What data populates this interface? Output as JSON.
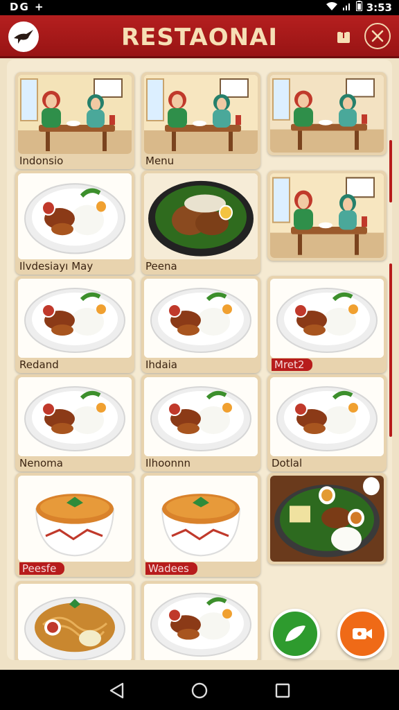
{
  "status_bar": {
    "left_text": "DG +",
    "time": "3:53"
  },
  "header": {
    "title": "RESTAONAI"
  },
  "cards": [
    {
      "label": "Indonsio",
      "style": "plain"
    },
    {
      "label": "Menu",
      "style": "plain"
    },
    {
      "label": "",
      "style": "plain"
    },
    {
      "label": "Ilvdesiayı May",
      "style": "plain"
    },
    {
      "label": "Peena",
      "style": "plain"
    },
    {
      "label": "",
      "style": "plain"
    },
    {
      "label": "Redand",
      "style": "plain"
    },
    {
      "label": "Ihdaia",
      "style": "plain"
    },
    {
      "label": "Mret2",
      "style": "pill"
    },
    {
      "label": "Nenoma",
      "style": "plain"
    },
    {
      "label": "Ilhoonnn",
      "style": "plain"
    },
    {
      "label": "Dotlal",
      "style": "plain"
    },
    {
      "label": "Peesfe",
      "style": "pill"
    },
    {
      "label": "Wadees",
      "style": "pill"
    },
    {
      "label": "",
      "style": "plain"
    },
    {
      "label": "",
      "style": "plain"
    },
    {
      "label": "",
      "style": "plain"
    }
  ],
  "icons": {
    "logo": "bird-logo-icon",
    "share": "share-icon",
    "close": "close-icon",
    "green_fab": "leaf-icon",
    "orange_fab": "video-camera-icon"
  },
  "colors": {
    "brand_red": "#b51f1f",
    "background": "#efe2c6",
    "fab_green": "#2e9b2e",
    "fab_orange": "#ef6a17"
  }
}
